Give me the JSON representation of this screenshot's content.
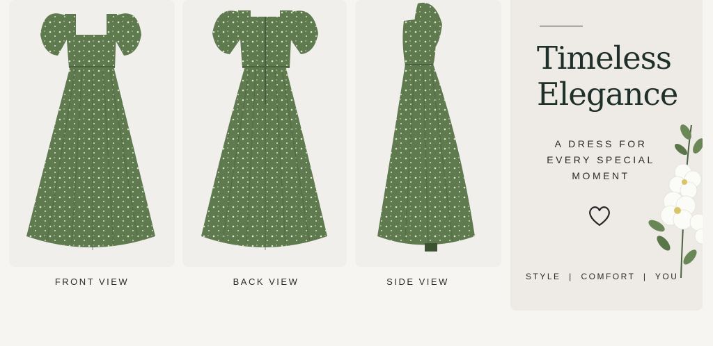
{
  "views": {
    "front_label": "FRONT VIEW",
    "back_label": "BACK VIEW",
    "side_label": "SIDE VIEW"
  },
  "promo": {
    "title_line1": "Timeless",
    "title_line2": "Elegance",
    "subtitle_line1": "A DRESS FOR",
    "subtitle_line2": "EVERY SPECIAL",
    "subtitle_line3": "MOMENT",
    "tagline": "STYLE  |  COMFORT  |  YOU"
  },
  "colors": {
    "dress_green": "#5f7a4e",
    "dress_shadow": "#4b6340",
    "floral_print": "#dfe6cf",
    "panel_bg": "#f1efec",
    "title_color": "#1f302a"
  },
  "icons": [
    "heart-icon",
    "white-flowers-decoration"
  ]
}
